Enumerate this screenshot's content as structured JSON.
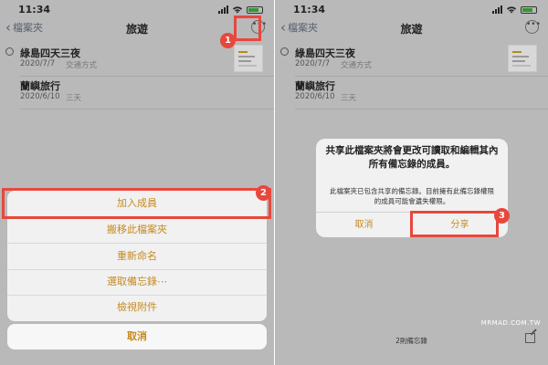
{
  "left": {
    "status": {
      "time": "11:34"
    },
    "nav": {
      "back_label": "檔案夾",
      "title": "旅遊",
      "more_icon": "ellipsis-circle-icon"
    },
    "notes": [
      {
        "title": "綠島四天三夜",
        "date": "2020/7/7",
        "subtitle": "交通方式",
        "shared": true
      },
      {
        "title": "蘭嶼旅行",
        "date": "2020/6/10",
        "subtitle": "三天",
        "shared": false
      }
    ],
    "action_sheet": {
      "items": [
        "加入成員",
        "搬移此檔案夾",
        "重新命名",
        "選取備忘錄⋯",
        "檢視附件"
      ],
      "cancel": "取消"
    },
    "badges": [
      "1",
      "2"
    ]
  },
  "right": {
    "status": {
      "time": "11:34"
    },
    "nav": {
      "back_label": "檔案夾",
      "title": "旅遊"
    },
    "notes": [
      {
        "title": "綠島四天三夜",
        "date": "2020/7/7",
        "subtitle": "交通方式",
        "shared": true
      },
      {
        "title": "蘭嶼旅行",
        "date": "2020/6/10",
        "subtitle": "三天",
        "shared": false
      }
    ],
    "alert": {
      "title": "共享此檔案夾將會更改可讀取和編輯其內所有備忘錄的成員。",
      "message": "此檔案夾已包含共享的備忘錄。目前擁有此備忘錄權限的成員可能會遺失權限。",
      "cancel": "取消",
      "share": "分享"
    },
    "badge": "3",
    "watermark": "MRMAD.COM.TW",
    "footer": "2則備忘錄"
  },
  "colors": {
    "accent": "#c58a1f",
    "highlight": "#e8473c",
    "dim_background": "#b9b9b9"
  }
}
